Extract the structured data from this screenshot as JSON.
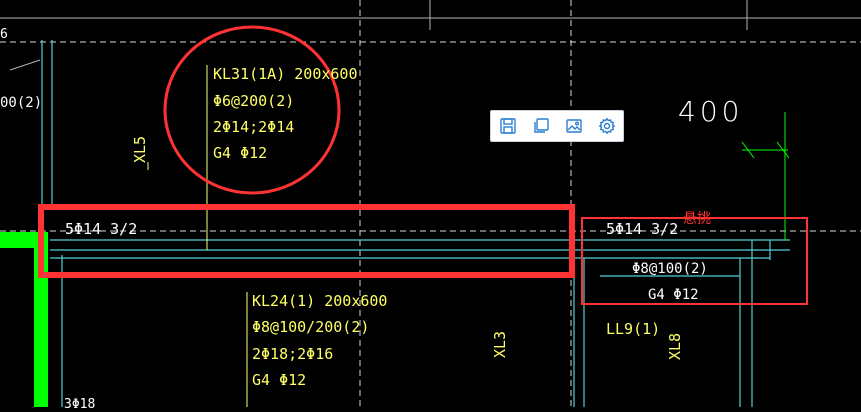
{
  "annotations": {
    "kl31": {
      "name": "KL31(1A) 200x600",
      "stirrup": "Φ6@200(2)",
      "rebar": "2Φ14;2Φ14",
      "side": "G4 Φ12"
    },
    "kl24": {
      "name": "KL24(1) 200x600",
      "stirrup": "Φ8@100/200(2)",
      "rebar": "2Φ18;2Φ16",
      "side": "G4 Φ12"
    },
    "beam_left_top": "5Φ14 3/2",
    "beam_right_top": "5Φ14 3/2",
    "cantilever": {
      "label": "悬挑",
      "stirrup": "Φ8@100(2)",
      "side": "G4 Φ12"
    },
    "ll9": "LL9(1)",
    "xl5": "XL5",
    "xl3": "XL3",
    "xl8": "XL8",
    "dim_400": "400",
    "left_edge_top": "00(2)",
    "left_edge_small": "6",
    "bottom_left": "3Φ18"
  },
  "toolbar": {
    "buttons": [
      {
        "icon": "save-icon"
      },
      {
        "icon": "copy-icon"
      },
      {
        "icon": "image-icon"
      },
      {
        "icon": "settings-icon"
      }
    ]
  },
  "colors": {
    "background": "#000000",
    "text_yellow": "#ffff66",
    "line_cyan": "#4fd1d9",
    "line_green": "#00ff00",
    "highlight_red": "#ff3333",
    "toolbar_icon": "#2a7fd4"
  }
}
